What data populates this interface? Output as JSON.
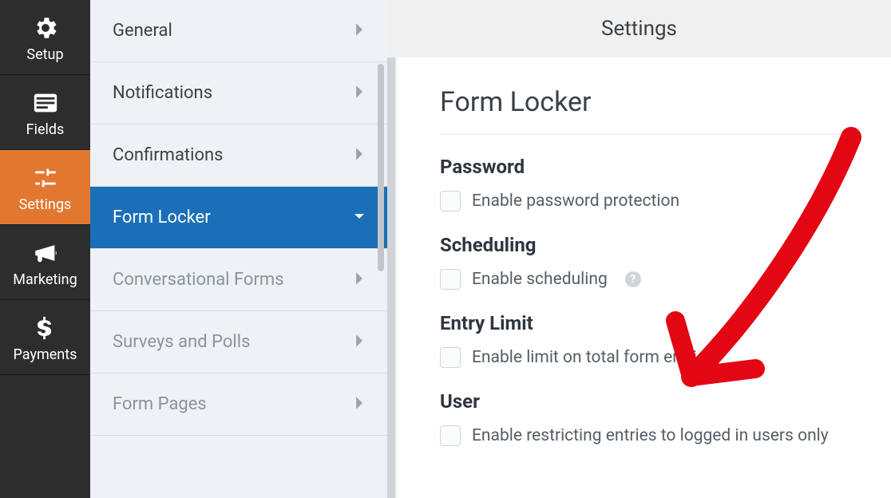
{
  "vnav": {
    "items": [
      {
        "label": "Setup",
        "icon": "gear-icon"
      },
      {
        "label": "Fields",
        "icon": "list-icon"
      },
      {
        "label": "Settings",
        "icon": "sliders-icon"
      },
      {
        "label": "Marketing",
        "icon": "bullhorn-icon"
      },
      {
        "label": "Payments",
        "icon": "dollar-icon"
      }
    ]
  },
  "sublist": {
    "items": [
      {
        "label": "General",
        "style": "normal"
      },
      {
        "label": "Notifications",
        "style": "normal"
      },
      {
        "label": "Confirmations",
        "style": "normal"
      },
      {
        "label": "Form Locker",
        "style": "active"
      },
      {
        "label": "Conversational Forms",
        "style": "dim"
      },
      {
        "label": "Surveys and Polls",
        "style": "dim"
      },
      {
        "label": "Form Pages",
        "style": "dim"
      }
    ]
  },
  "main": {
    "header_title": "Settings",
    "content_title": "Form Locker",
    "sections": {
      "password": {
        "heading": "Password",
        "check_label": "Enable password protection"
      },
      "scheduling": {
        "heading": "Scheduling",
        "check_label": "Enable scheduling"
      },
      "entry_limit": {
        "heading": "Entry Limit",
        "check_label": "Enable limit on total form entries"
      },
      "user": {
        "heading": "User",
        "check_label": "Enable restricting entries to logged in users only"
      }
    }
  }
}
